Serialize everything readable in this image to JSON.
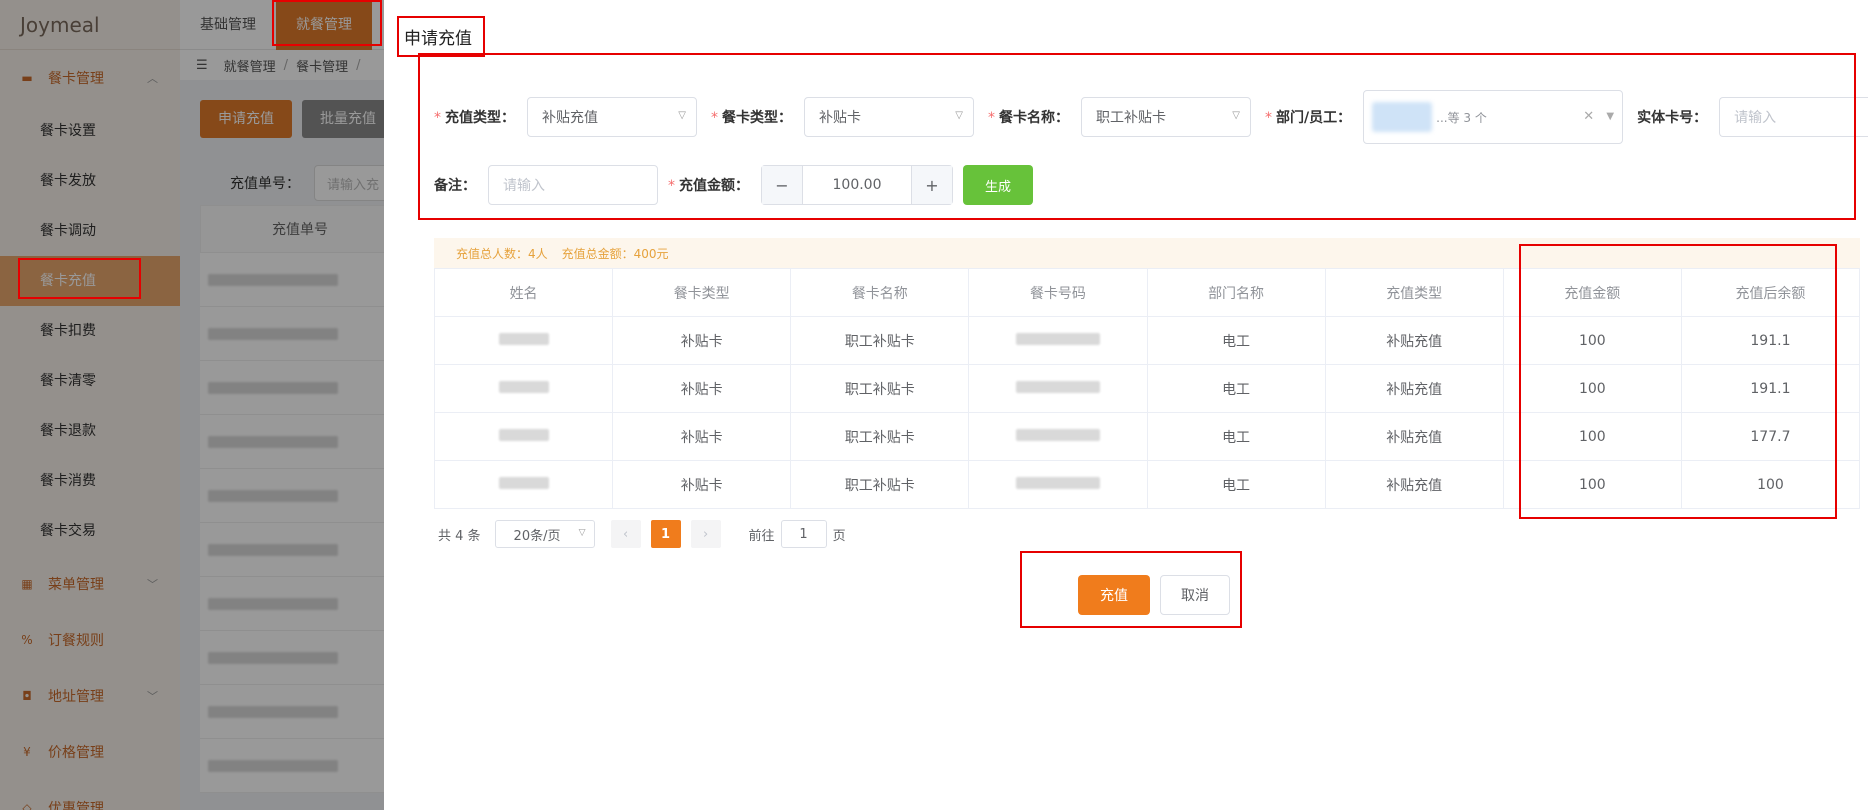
{
  "app": {
    "logo": "Joymeal"
  },
  "topnav": [
    "基础管理",
    "就餐管理"
  ],
  "breadcrumb": [
    "就餐管理",
    "餐卡管理"
  ],
  "sidebar": {
    "group_card": "餐卡管理",
    "items": [
      {
        "label": "餐卡设置"
      },
      {
        "label": "餐卡发放"
      },
      {
        "label": "餐卡调动"
      },
      {
        "label": "餐卡充值"
      },
      {
        "label": "餐卡扣费"
      },
      {
        "label": "餐卡清零"
      },
      {
        "label": "餐卡退款"
      },
      {
        "label": "餐卡消费"
      },
      {
        "label": "餐卡交易"
      }
    ],
    "groups": [
      "菜单管理",
      "订餐规则",
      "地址管理",
      "价格管理",
      "优惠管理"
    ]
  },
  "bg": {
    "apply_btn": "申请充值",
    "batch_btn": "批量充值",
    "search_label": "充值单号：",
    "search_placeholder": "请输入充",
    "col_header": "充值单号"
  },
  "dialog": {
    "title": "申请充值",
    "form": {
      "recharge_type_label": "充值类型：",
      "recharge_type_value": "补贴充值",
      "card_type_label": "餐卡类型：",
      "card_type_value": "补贴卡",
      "card_name_label": "餐卡名称：",
      "card_name_value": "职工补贴卡",
      "dept_label": "部门/员工：",
      "dept_more": "...等 3 个",
      "physical_card_label": "实体卡号：",
      "physical_card_placeholder": "请输入",
      "remark_label": "备注：",
      "remark_placeholder": "请输入",
      "amount_label": "充值金额：",
      "amount_value": "100.00",
      "generate_btn": "生成"
    },
    "summary": {
      "people": "充值总人数：4人",
      "total": "充值总金额：400元"
    },
    "table": {
      "headers": [
        "姓名",
        "餐卡类型",
        "餐卡名称",
        "餐卡号码",
        "部门名称",
        "充值类型",
        "充值金额",
        "充值后余额"
      ],
      "rows": [
        {
          "card_type": "补贴卡",
          "card_name": "职工补贴卡",
          "dept": "电工",
          "type": "补贴充值",
          "amount": "100",
          "balance": "191.1"
        },
        {
          "card_type": "补贴卡",
          "card_name": "职工补贴卡",
          "dept": "电工",
          "type": "补贴充值",
          "amount": "100",
          "balance": "191.1"
        },
        {
          "card_type": "补贴卡",
          "card_name": "职工补贴卡",
          "dept": "电工",
          "type": "补贴充值",
          "amount": "100",
          "balance": "177.7"
        },
        {
          "card_type": "补贴卡",
          "card_name": "职工补贴卡",
          "dept": "电工",
          "type": "补贴充值",
          "amount": "100",
          "balance": "100"
        }
      ]
    },
    "pager": {
      "total": "共 4 条",
      "page_size": "20条/页",
      "current": "1",
      "goto_prefix": "前往",
      "goto_value": "1",
      "goto_suffix": "页"
    },
    "buttons": {
      "confirm": "充值",
      "cancel": "取消"
    }
  }
}
